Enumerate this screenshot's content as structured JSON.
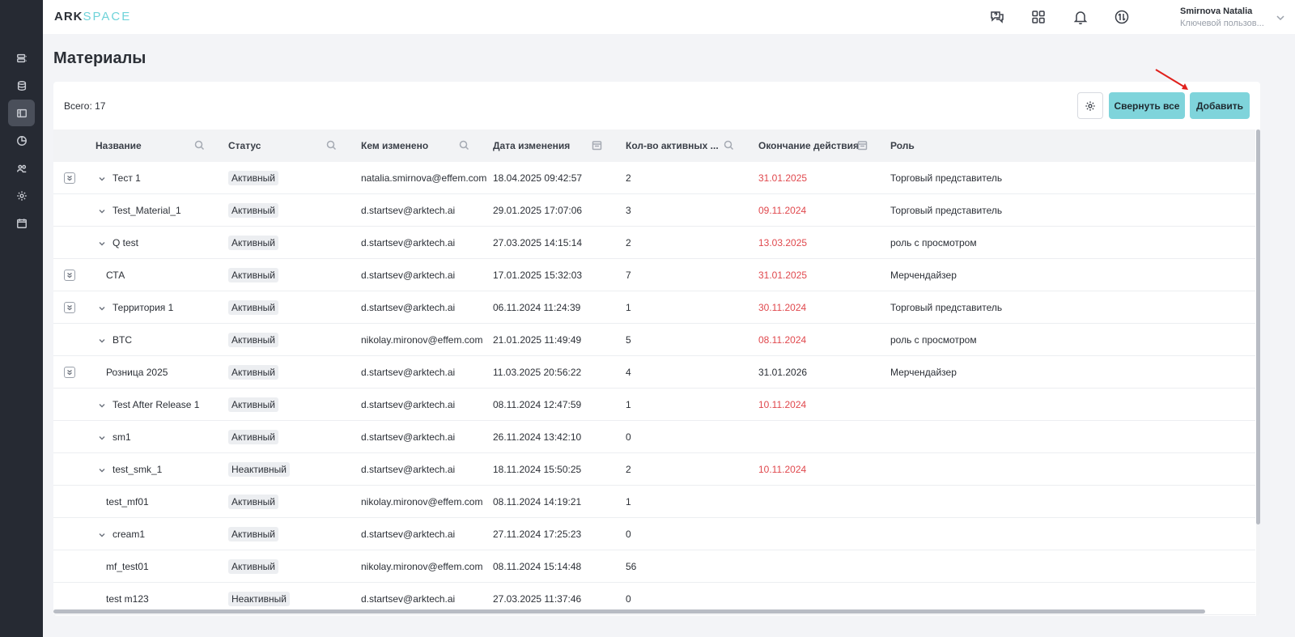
{
  "app": {
    "logo_part1": "ARK",
    "logo_part2": "SPACE"
  },
  "sidebar": {
    "items": [
      {
        "icon": "list-icon"
      },
      {
        "icon": "database-icon"
      },
      {
        "icon": "materials-icon",
        "active": true
      },
      {
        "icon": "chart-icon"
      },
      {
        "icon": "users-icon"
      },
      {
        "icon": "gear-icon"
      },
      {
        "icon": "calendar-icon"
      }
    ]
  },
  "header": {
    "icons": [
      "help-chat-icon",
      "apps-grid-icon",
      "bell-icon",
      "sync-icon"
    ],
    "user_name": "Smirnova Natalia",
    "user_role": "Ключевой пользов..."
  },
  "page": {
    "title": "Материалы"
  },
  "toolbar": {
    "total": "Всего: 17",
    "collapse_label": "Свернуть все",
    "add_label": "Добавить"
  },
  "table": {
    "columns": [
      {
        "label": "Название",
        "filter": "search"
      },
      {
        "label": "Статус",
        "filter": "search"
      },
      {
        "label": "Кем изменено",
        "filter": "search"
      },
      {
        "label": "Дата изменения",
        "filter": "calendar"
      },
      {
        "label": "Кол-во активных ...",
        "filter": "search"
      },
      {
        "label": "Окончание действия",
        "filter": "calendar"
      },
      {
        "label": "Роль",
        "filter": ""
      }
    ],
    "rows": [
      {
        "expand_box": true,
        "chevron": true,
        "name": "Тест 1",
        "status": "Активный",
        "changed_by": "natalia.smirnova@effem.com",
        "changed_at": "18.04.2025 09:42:57",
        "active_count": "2",
        "end_date": "31.01.2025",
        "end_overdue": true,
        "role": "Торговый представитель"
      },
      {
        "expand_box": false,
        "chevron": true,
        "name": "Test_Material_1",
        "status": "Активный",
        "changed_by": "d.startsev@arktech.ai",
        "changed_at": "29.01.2025 17:07:06",
        "active_count": "3",
        "end_date": "09.11.2024",
        "end_overdue": true,
        "role": "Торговый представитель"
      },
      {
        "expand_box": false,
        "chevron": true,
        "name": "Q test",
        "status": "Активный",
        "changed_by": "d.startsev@arktech.ai",
        "changed_at": "27.03.2025 14:15:14",
        "active_count": "2",
        "end_date": "13.03.2025",
        "end_overdue": true,
        "role": "роль с просмотром"
      },
      {
        "expand_box": true,
        "chevron": false,
        "name": "СТА",
        "status": "Активный",
        "changed_by": "d.startsev@arktech.ai",
        "changed_at": "17.01.2025 15:32:03",
        "active_count": "7",
        "end_date": "31.01.2025",
        "end_overdue": true,
        "role": "Мерчендайзер"
      },
      {
        "expand_box": true,
        "chevron": true,
        "name": "Территория 1",
        "status": "Активный",
        "changed_by": "d.startsev@arktech.ai",
        "changed_at": "06.11.2024 11:24:39",
        "active_count": "1",
        "end_date": "30.11.2024",
        "end_overdue": true,
        "role": "Торговый представитель"
      },
      {
        "expand_box": false,
        "chevron": true,
        "name": "BTC",
        "status": "Активный",
        "changed_by": "nikolay.mironov@effem.com",
        "changed_at": "21.01.2025 11:49:49",
        "active_count": "5",
        "end_date": "08.11.2024",
        "end_overdue": true,
        "role": "роль с просмотром"
      },
      {
        "expand_box": true,
        "chevron": false,
        "name": "Розница 2025",
        "status": "Активный",
        "changed_by": "d.startsev@arktech.ai",
        "changed_at": "11.03.2025 20:56:22",
        "active_count": "4",
        "end_date": "31.01.2026",
        "end_overdue": false,
        "role": "Мерчендайзер"
      },
      {
        "expand_box": false,
        "chevron": true,
        "name": "Test After Release 1",
        "status": "Активный",
        "changed_by": "d.startsev@arktech.ai",
        "changed_at": "08.11.2024 12:47:59",
        "active_count": "1",
        "end_date": "10.11.2024",
        "end_overdue": true,
        "role": ""
      },
      {
        "expand_box": false,
        "chevron": true,
        "name": "sm1",
        "status": "Активный",
        "changed_by": "d.startsev@arktech.ai",
        "changed_at": "26.11.2024 13:42:10",
        "active_count": "0",
        "end_date": "",
        "end_overdue": false,
        "role": ""
      },
      {
        "expand_box": false,
        "chevron": true,
        "name": "test_smk_1",
        "status": "Неактивный",
        "changed_by": "d.startsev@arktech.ai",
        "changed_at": "18.11.2024 15:50:25",
        "active_count": "2",
        "end_date": "10.11.2024",
        "end_overdue": true,
        "role": ""
      },
      {
        "expand_box": false,
        "chevron": false,
        "name": "test_mf01",
        "status": "Активный",
        "changed_by": "nikolay.mironov@effem.com",
        "changed_at": "08.11.2024 14:19:21",
        "active_count": "1",
        "end_date": "",
        "end_overdue": false,
        "role": ""
      },
      {
        "expand_box": false,
        "chevron": true,
        "name": "cream1",
        "status": "Активный",
        "changed_by": "d.startsev@arktech.ai",
        "changed_at": "27.11.2024 17:25:23",
        "active_count": "0",
        "end_date": "",
        "end_overdue": false,
        "role": ""
      },
      {
        "expand_box": false,
        "chevron": false,
        "name": "mf_test01",
        "status": "Активный",
        "changed_by": "nikolay.mironov@effem.com",
        "changed_at": "08.11.2024 15:14:48",
        "active_count": "56",
        "end_date": "",
        "end_overdue": false,
        "role": ""
      },
      {
        "expand_box": false,
        "chevron": false,
        "name": "test m123",
        "status": "Неактивный",
        "changed_by": "d.startsev@arktech.ai",
        "changed_at": "27.03.2025 11:37:46",
        "active_count": "0",
        "end_date": "",
        "end_overdue": false,
        "role": ""
      }
    ]
  },
  "colors": {
    "accent": "#7fd4db",
    "sidebar_bg": "#262a33",
    "overdue": "#e0484d",
    "annotation_arrow": "#e0201c"
  }
}
